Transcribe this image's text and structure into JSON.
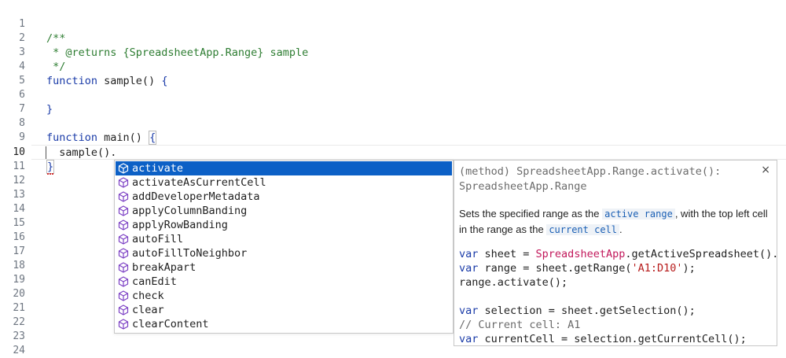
{
  "editor": {
    "line_numbers": [
      "1",
      "2",
      "3",
      "4",
      "5",
      "6",
      "7",
      "8",
      "9",
      "10",
      "11",
      "12",
      "13",
      "14",
      "15",
      "16",
      "17",
      "18",
      "19",
      "20",
      "21",
      "22",
      "23",
      "24"
    ],
    "lines": {
      "l2": "/**",
      "l3": " * @returns {SpreadsheetApp.Range} sample",
      "l4": " */",
      "l5_kw": "function",
      "l5_rest": " sample() ",
      "l5_brace": "{",
      "l7_brace": "}",
      "l9_kw": "function",
      "l9_rest": " main() ",
      "l9_brace": "{",
      "l10": "  sample().",
      "l11_brace": "}"
    }
  },
  "suggest": {
    "items": [
      "activate",
      "activateAsCurrentCell",
      "addDeveloperMetadata",
      "applyColumnBanding",
      "applyRowBanding",
      "autoFill",
      "autoFillToNeighbor",
      "breakApart",
      "canEdit",
      "check",
      "clear",
      "clearContent"
    ],
    "icon": "method-cube-icon",
    "selected_index": 0,
    "colors": {
      "selected_bg": "#0c60c6",
      "icon": "#7b3fc4"
    }
  },
  "details": {
    "signature": "(method) SpreadsheetApp.Range.activate(): SpreadsheetApp.Range",
    "close": "×",
    "desc_1": "Sets the specified range as the ",
    "desc_tag1": "active range",
    "desc_2": ", with the top left cell in the range as the ",
    "desc_tag2": "current cell",
    "desc_3": ".",
    "code": {
      "c1_kw": "var",
      "c1_a": " sheet = ",
      "c1_cls": "SpreadsheetApp",
      "c1_b": ".getActiveSpreadsheet().ge",
      "c2_kw": "var",
      "c2_a": " range = sheet.getRange(",
      "c2_str": "'A1:D10'",
      "c2_b": ");",
      "c3": "range.activate();",
      "c5_kw": "var",
      "c5_a": " selection = sheet.getSelection();",
      "c6": "// Current cell: A1",
      "c7_kw": "var",
      "c7_a": " currentCell = selection.getCurrentCell();"
    }
  }
}
